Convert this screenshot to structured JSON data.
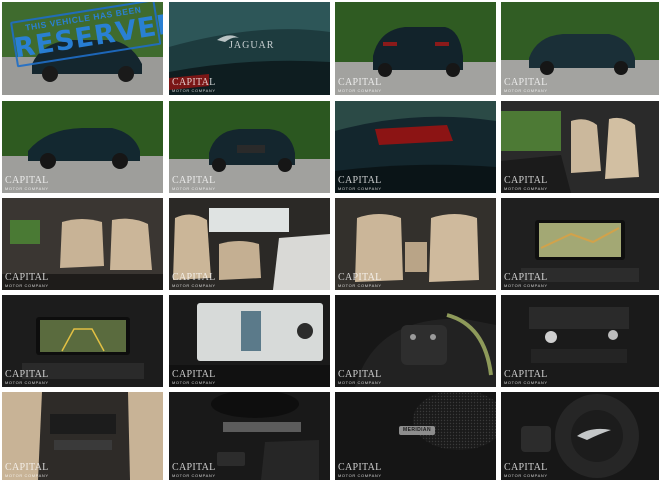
{
  "watermark": {
    "brand": "CAPITAL",
    "tagline": "MOTOR COMPANY"
  },
  "stamp": {
    "line1": "THIS VEHICLE HAS BEEN",
    "line2": "RESERVED"
  },
  "badges": {
    "tailgate": "JAGUAR",
    "speaker": "MERIDIAN"
  },
  "photos": [
    {
      "id": "exterior-front-reserved"
    },
    {
      "id": "tailgate-badge"
    },
    {
      "id": "exterior-rear-quarter"
    },
    {
      "id": "exterior-front-quarter"
    },
    {
      "id": "exterior-side"
    },
    {
      "id": "exterior-front"
    },
    {
      "id": "taillight"
    },
    {
      "id": "front-seats"
    },
    {
      "id": "rear-seats"
    },
    {
      "id": "dashboard-passenger"
    },
    {
      "id": "rear-bench"
    },
    {
      "id": "navigation-screen"
    },
    {
      "id": "backup-camera"
    },
    {
      "id": "climate-screen"
    },
    {
      "id": "steering-wheel-buttons"
    },
    {
      "id": "center-console"
    },
    {
      "id": "rear-vents"
    },
    {
      "id": "gear-selector"
    },
    {
      "id": "meridian-speaker"
    },
    {
      "id": "steering-wheel-logo"
    }
  ]
}
